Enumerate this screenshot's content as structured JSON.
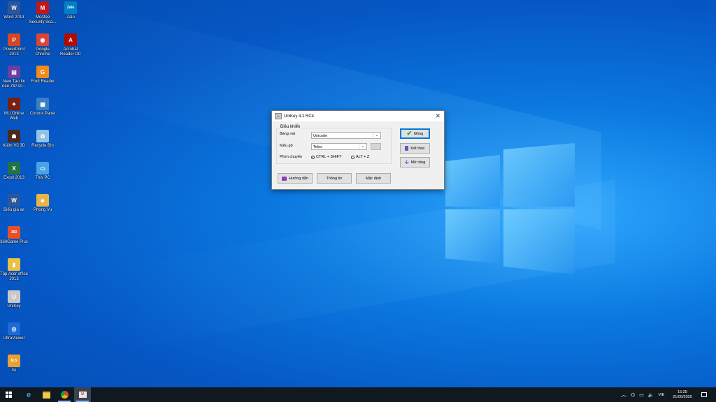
{
  "desktop_icons": [
    {
      "label": "Word 2013",
      "icon": "word-icon",
      "color": "#2b579a",
      "glyph": "W"
    },
    {
      "label": "McAfee Security Sca...",
      "icon": "mcafee-icon",
      "color": "#c0171d",
      "glyph": "M"
    },
    {
      "label": "Zalo",
      "icon": "zalo-icon",
      "color": "#0180c7",
      "glyph": "Zalo"
    },
    {
      "label": "PowerPoint 2013",
      "icon": "powerpoint-icon",
      "color": "#d24726",
      "glyph": "P"
    },
    {
      "label": "Google Chrome",
      "icon": "chrome-icon",
      "color": "#db4437",
      "glyph": "◉"
    },
    {
      "label": "Acrobat Reader DC",
      "icon": "acrobat-icon",
      "color": "#b30b00",
      "glyph": "A"
    },
    {
      "label": "New Tạo tin nén ZIP All...",
      "icon": "winrar-icon",
      "color": "#6b3fa0",
      "glyph": "▤"
    },
    {
      "label": "Foxit Reader",
      "icon": "foxit-icon",
      "color": "#f08c1a",
      "glyph": "G"
    },
    {
      "label": "MU Online Web",
      "icon": "mu-online-icon",
      "color": "#7a1f12",
      "glyph": "✦"
    },
    {
      "label": "Control Panel",
      "icon": "control-panel-icon",
      "color": "#3a7fc4",
      "glyph": "▦"
    },
    {
      "label": "Kiếm Vũ 3D",
      "icon": "kiem-vu-icon",
      "color": "#4a2a1a",
      "glyph": "☗"
    },
    {
      "label": "Recycle Bin",
      "icon": "recycle-bin-icon",
      "color": "#8fc3e8",
      "glyph": "♻"
    },
    {
      "label": "Excel 2013",
      "icon": "excel-icon",
      "color": "#217346",
      "glyph": "X"
    },
    {
      "label": "This PC",
      "icon": "this-pc-icon",
      "color": "#4aa3e8",
      "glyph": "▭"
    },
    {
      "label": "Biểu giá xe",
      "icon": "document-icon",
      "color": "#2b579a",
      "glyph": "W"
    },
    {
      "label": "Phong Vu",
      "icon": "user-folder-icon",
      "color": "#e8b54a",
      "glyph": "☻"
    },
    {
      "label": "360Game Plus",
      "icon": "game360-icon",
      "color": "#e8502a",
      "glyph": "360"
    },
    {
      "label": "Tập Acer office 2013",
      "icon": "folder-icon",
      "color": "#e8c04a",
      "glyph": "▮"
    },
    {
      "label": "UniKey",
      "icon": "unikey-icon",
      "color": "#c8c8c8",
      "glyph": "U"
    },
    {
      "label": "UltraViewer",
      "icon": "ultraviewer-icon",
      "color": "#1e6ad6",
      "glyph": "◎"
    },
    {
      "label": "tsi",
      "icon": "tsi-icon",
      "color": "#e8a030",
      "glyph": "M.S"
    }
  ],
  "dialog": {
    "title": "UniKey 4.2 RC4",
    "group_title": "Điều khiển",
    "bang_ma_label": "Bảng mã",
    "bang_ma_value": "Unicode",
    "kieu_go_label": "Kiểu gõ",
    "kieu_go_value": "Telex",
    "phim_chuyen_label": "Phím chuyển",
    "radio_ctrl_shift": "CTRL + SHIFT",
    "radio_alt_z": "ALT + Z",
    "btn_dong": "Đóng",
    "btn_ket_thuc": "Kết thúc",
    "btn_mo_rong": "Mở rộng",
    "btn_huong_dan": "Hướng dẫn",
    "btn_thong_tin": "Thông tin",
    "btn_mac_dinh": "Mặc định"
  },
  "taskbar": {
    "lang": "VIE",
    "time": "15:25",
    "date": "21/05/2020"
  },
  "colors": {
    "taskbar": "#101820",
    "dialog_bg": "#f0f0f0",
    "accent": "#0078d7"
  }
}
